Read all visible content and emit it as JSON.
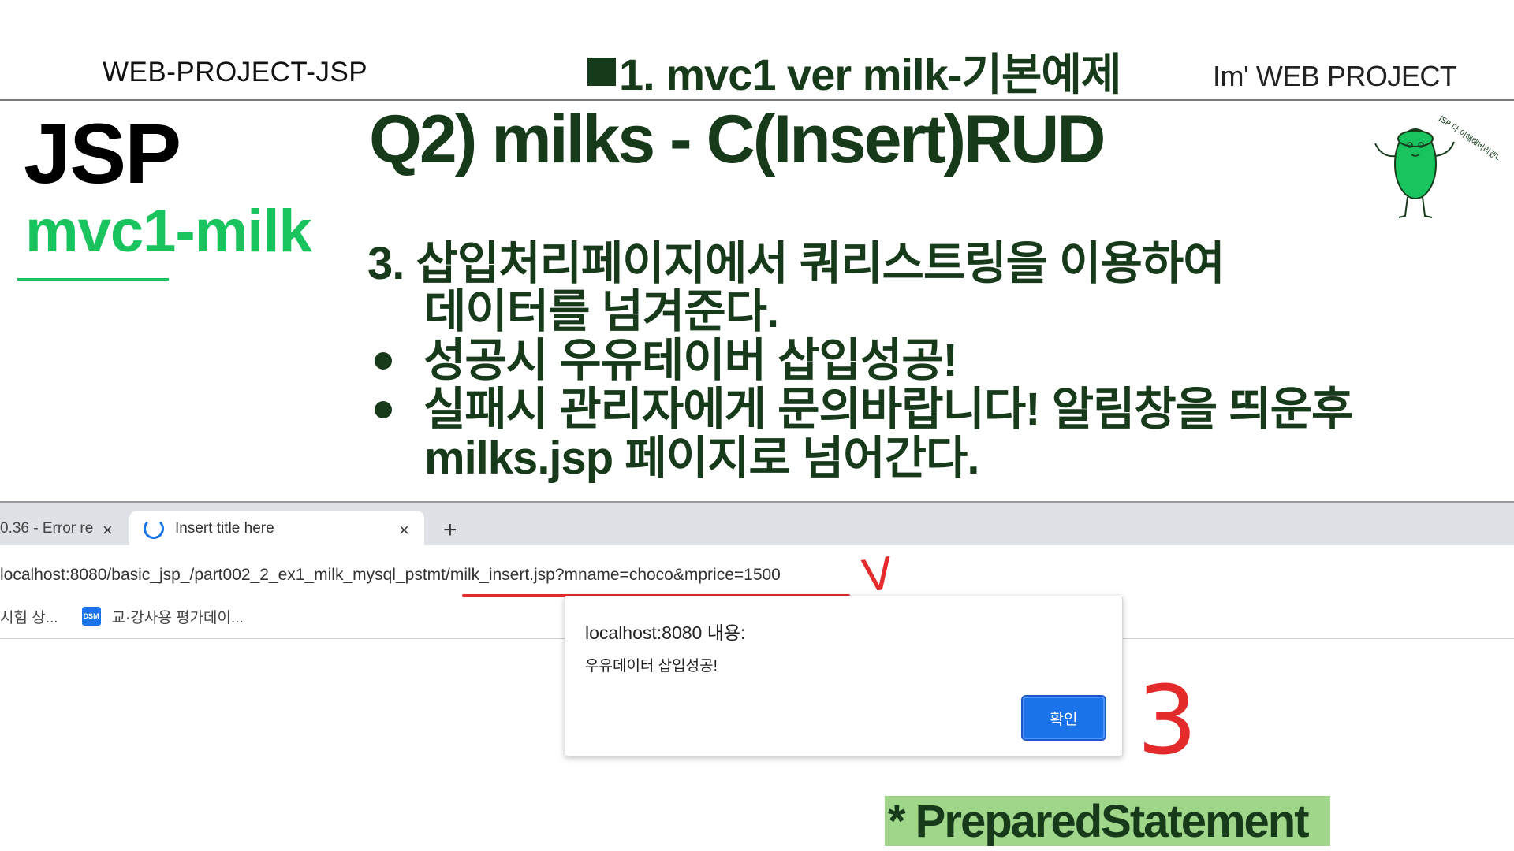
{
  "header": {
    "left": "WEB-PROJECT-JSP",
    "center": "1. mvc1 ver  milk-기본예제",
    "right": "Im'  WEB PROJECT"
  },
  "sidebar": {
    "title": "JSP",
    "subtitle": "mvc1-milk"
  },
  "main": {
    "heading": "Q2) milks - C(Insert)RUD",
    "step_line1": "3. 삽입처리페이지에서 쿼리스트링을 이용하여",
    "step_line2": "데이터를 넘겨준다.",
    "bullets": [
      "성공시 우유테이버 삽입성공!",
      "실패시 관리자에게 문의바랍니다! 알림창을 띄운후"
    ],
    "bullet2_cont": "milks.jsp 페이지로 넘어간다."
  },
  "mascot_text": "JSP 다 이해해버리겠다~!",
  "browser": {
    "tab_inactive": "0.36 - Error re",
    "tab_active": "Insert title here",
    "tab_close": "×",
    "tab_new": "+",
    "url": "localhost:8080/basic_jsp_/part002_2_ex1_milk_mysql_pstmt/milk_insert.jsp?mname=choco&mprice=1500",
    "bookmark1": "시험 상...",
    "bookmark2_icon": "DSM",
    "bookmark2": "교·강사용 평가데이...",
    "dialog": {
      "title": "localhost:8080 내용:",
      "message": "우유데이터 삽입성공!",
      "ok": "확인"
    }
  },
  "annotations": {
    "mark_v": "V",
    "mark_3": "3"
  },
  "badge": "* PreparedStatement",
  "colors": {
    "dark_green": "#173a1a",
    "bright_green": "#19c35e",
    "badge_bg": "#9fd68a",
    "red_annotation": "#e32b2b",
    "chrome_blue": "#1a73e8"
  }
}
